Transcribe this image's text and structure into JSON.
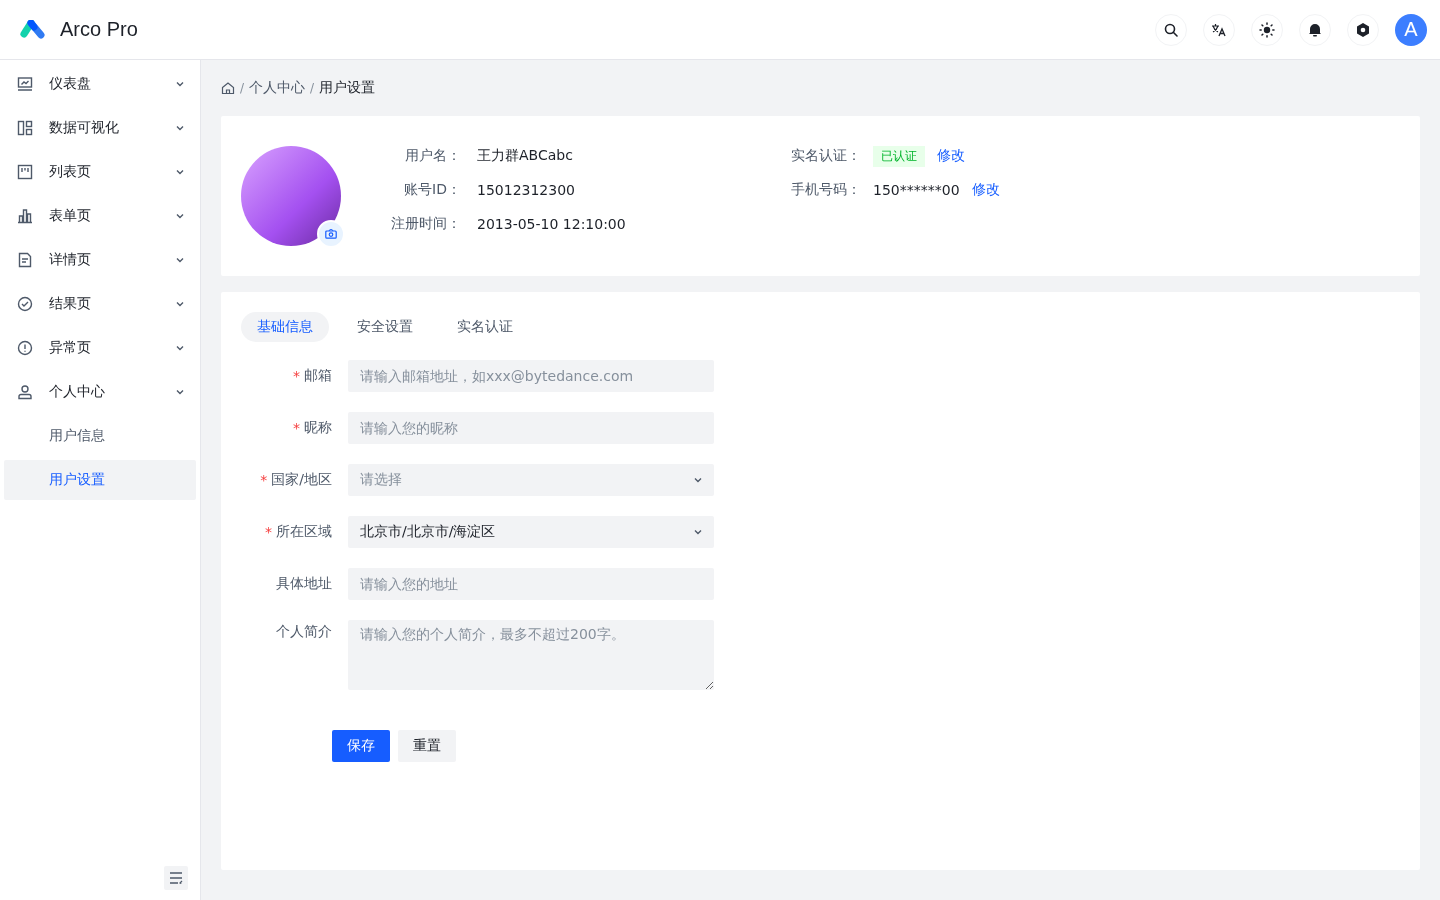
{
  "header": {
    "title": "Arco Pro",
    "avatar": "A"
  },
  "sidebar": {
    "items": [
      {
        "label": "仪表盘"
      },
      {
        "label": "数据可视化"
      },
      {
        "label": "列表页"
      },
      {
        "label": "表单页"
      },
      {
        "label": "详情页"
      },
      {
        "label": "结果页"
      },
      {
        "label": "异常页"
      },
      {
        "label": "个人中心",
        "children": [
          {
            "label": "用户信息",
            "selected": false
          },
          {
            "label": "用户设置",
            "selected": true
          }
        ]
      }
    ]
  },
  "breadcrumb": {
    "separator": "/",
    "items": [
      "个人中心",
      "用户设置"
    ]
  },
  "required_mark": "*",
  "profile": {
    "left": [
      {
        "label": "用户名：",
        "value": "王力群ABCabc"
      },
      {
        "label": "账号ID：",
        "value": "15012312300"
      },
      {
        "label": "注册时间：",
        "value": "2013-05-10 12:10:00"
      }
    ],
    "right": [
      {
        "label": "实名认证：",
        "tag": "已认证",
        "link": "修改"
      },
      {
        "label": "手机号码：",
        "value": "150******00",
        "link": "修改"
      }
    ]
  },
  "tabs": [
    {
      "label": "基础信息",
      "selected": true
    },
    {
      "label": "安全设置",
      "selected": false
    },
    {
      "label": "实名认证",
      "selected": false
    }
  ],
  "form": [
    {
      "kind": "input",
      "label": "邮箱",
      "required": true,
      "placeholder": "请输入邮箱地址，如xxx@bytedance.com"
    },
    {
      "kind": "input",
      "label": "昵称",
      "required": true,
      "placeholder": "请输入您的昵称"
    },
    {
      "kind": "select",
      "label": "国家/地区",
      "required": true,
      "placeholder": "请选择"
    },
    {
      "kind": "select",
      "label": "所在区域",
      "required": true,
      "value": "北京市/北京市/海淀区"
    },
    {
      "kind": "input",
      "label": "具体地址",
      "required": false,
      "placeholder": "请输入您的地址"
    },
    {
      "kind": "textarea",
      "label": "个人简介",
      "required": false,
      "placeholder": "请输入您的个人简介，最多不超过200字。"
    }
  ],
  "buttons": [
    {
      "label": "保存",
      "kind": "primary"
    },
    {
      "label": "重置",
      "kind": "secondary"
    }
  ]
}
